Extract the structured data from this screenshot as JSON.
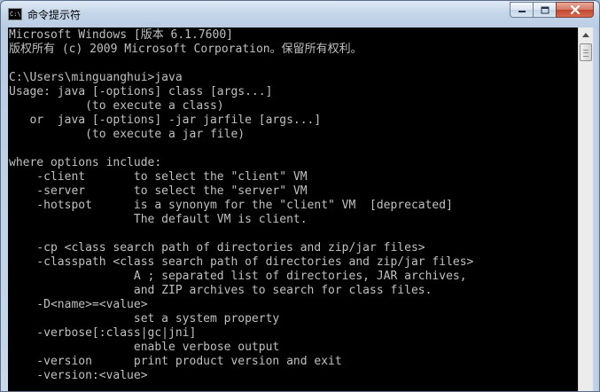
{
  "window": {
    "title": "命令提示符",
    "icon_text": "C:\\",
    "icon": "console-app-icon"
  },
  "caption_buttons": {
    "minimize": "minimize-icon",
    "maximize": "maximize-icon",
    "close": "close-icon"
  },
  "console": {
    "lines": [
      "Microsoft Windows [版本 6.1.7600]",
      "版权所有 (c) 2009 Microsoft Corporation。保留所有权利。",
      "",
      "C:\\Users\\minguanghui>java",
      "Usage: java [-options] class [args...]",
      "           (to execute a class)",
      "   or  java [-options] -jar jarfile [args...]",
      "           (to execute a jar file)",
      "",
      "where options include:",
      "    -client       to select the \"client\" VM",
      "    -server       to select the \"server\" VM",
      "    -hotspot      is a synonym for the \"client\" VM  [deprecated]",
      "                  The default VM is client.",
      "",
      "    -cp <class search path of directories and zip/jar files>",
      "    -classpath <class search path of directories and zip/jar files>",
      "                  A ; separated list of directories, JAR archives,",
      "                  and ZIP archives to search for class files.",
      "    -D<name>=<value>",
      "                  set a system property",
      "    -verbose[:class|gc|jni]",
      "                  enable verbose output",
      "    -version      print product version and exit",
      "    -version:<value>"
    ]
  },
  "scrollbar": {
    "up_arrow": "scroll-up-arrow-icon",
    "position_fraction": 0.0
  }
}
